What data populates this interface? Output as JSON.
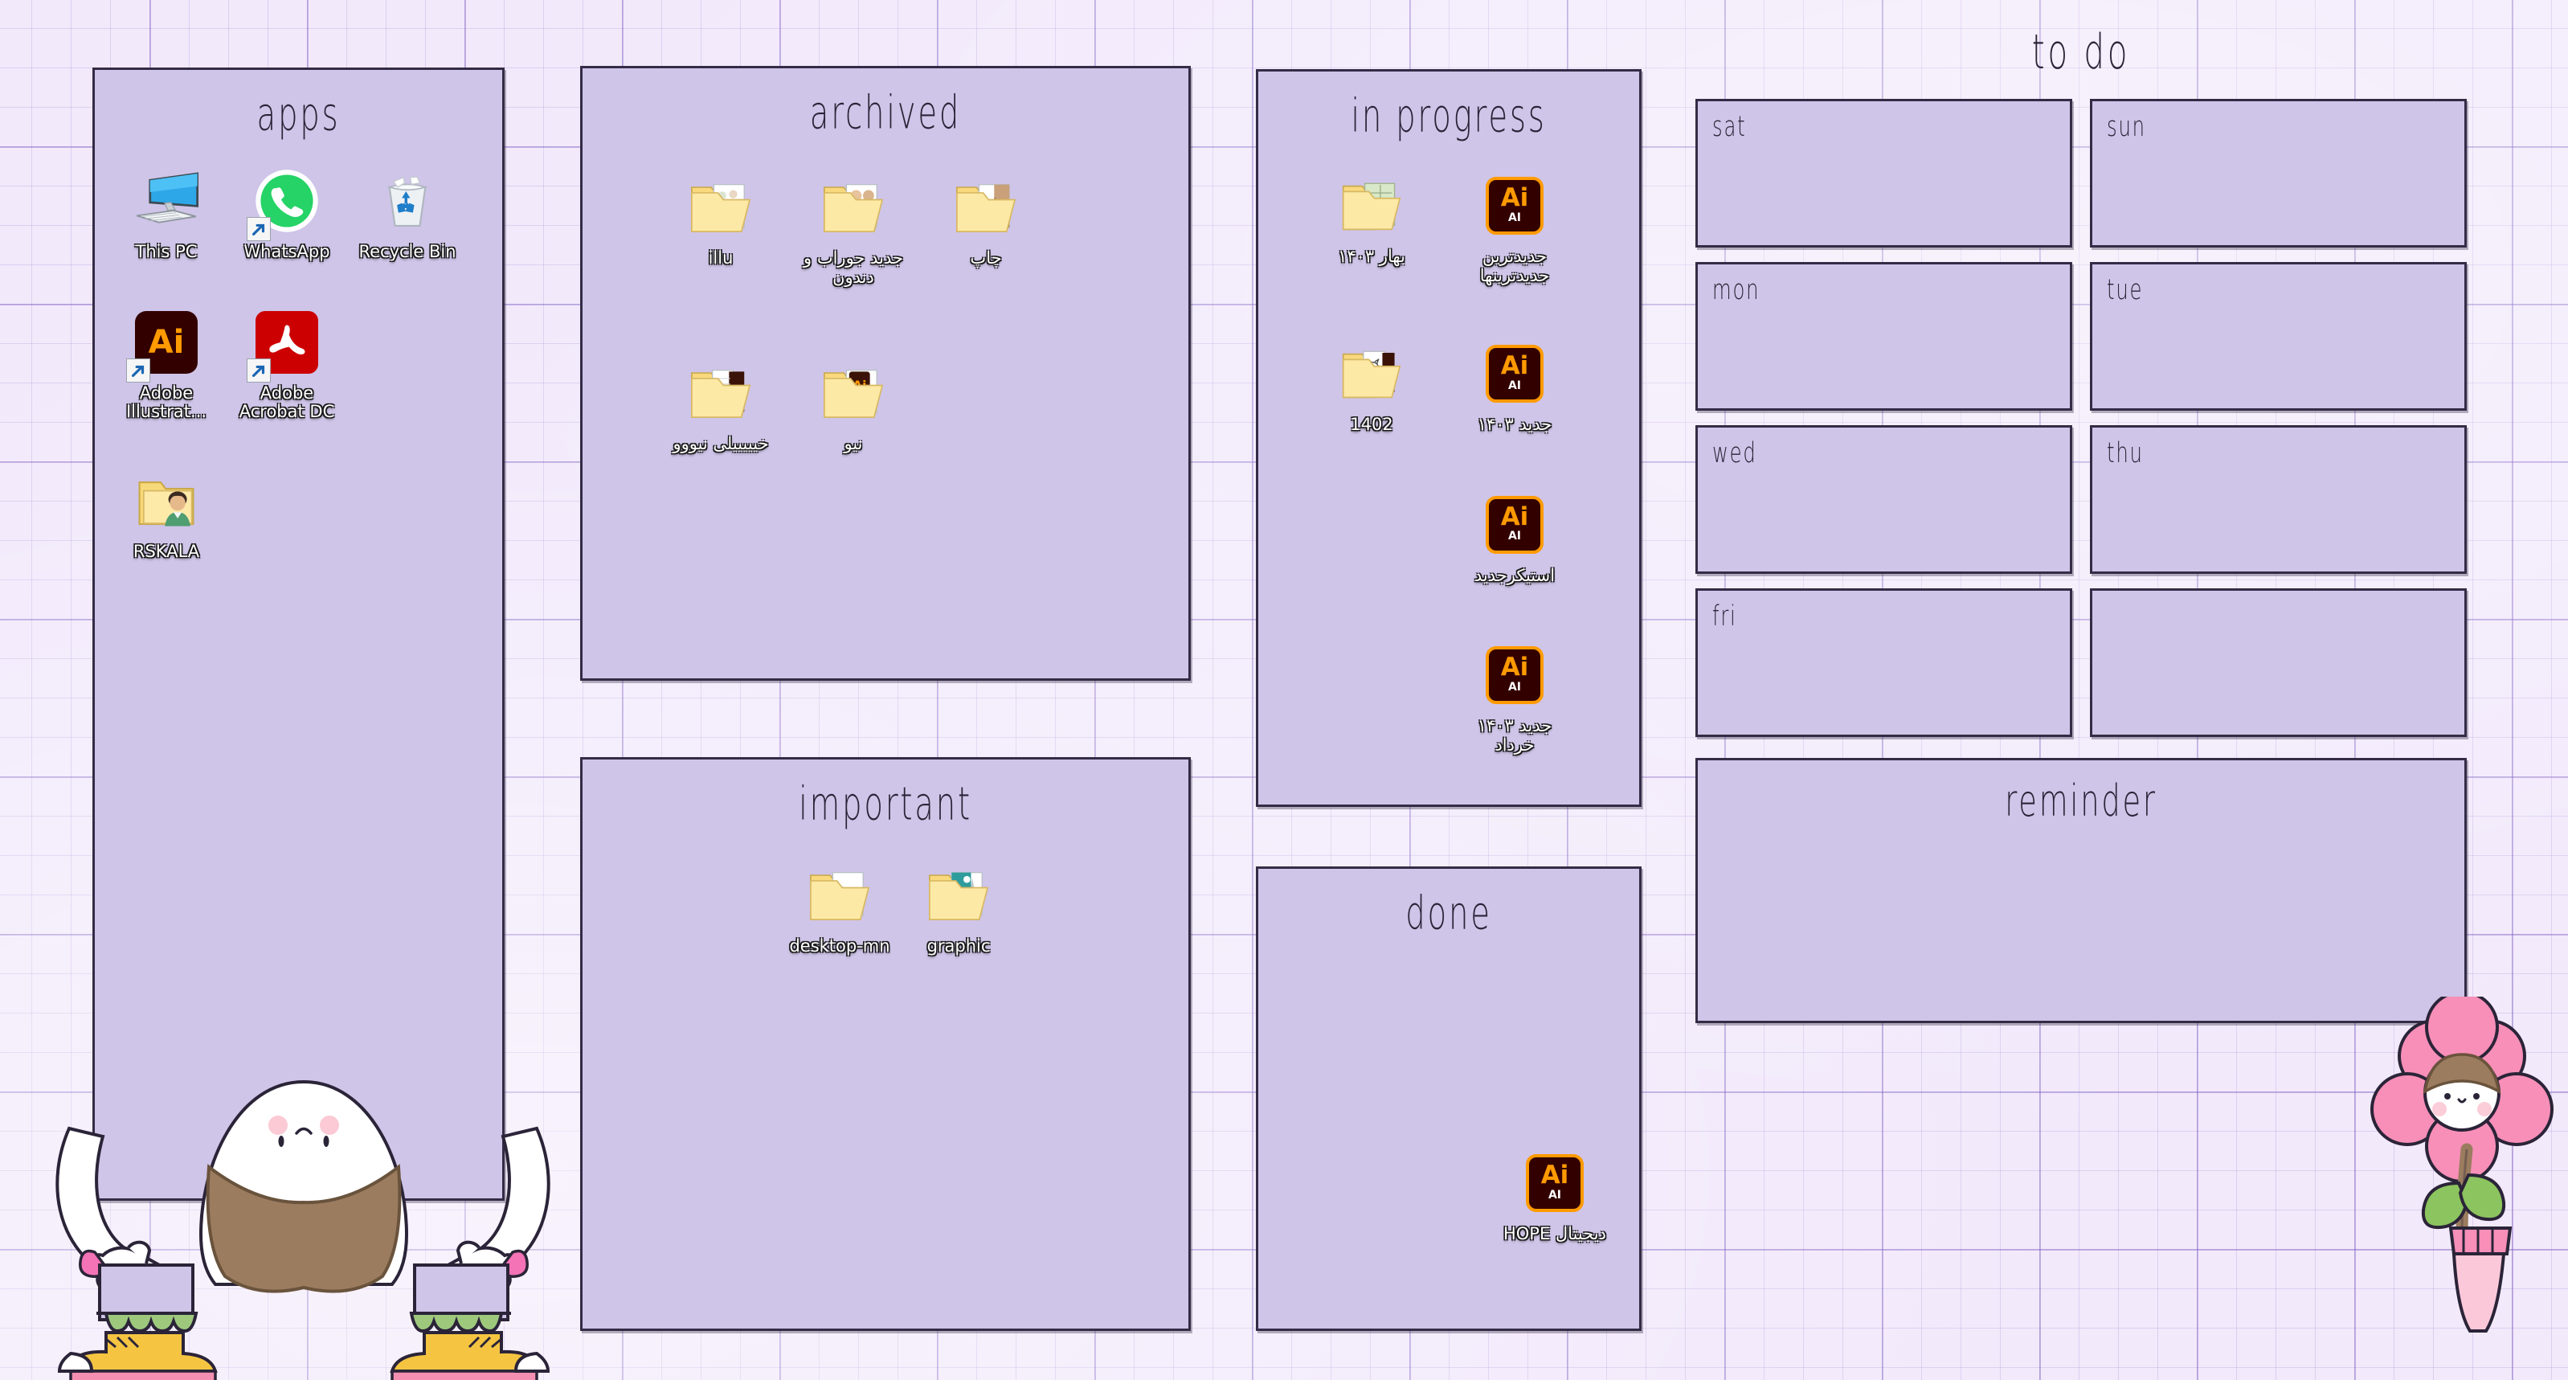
{
  "wallpaper": {
    "style": "grid-paper",
    "background_color": "#f2e9fb",
    "grid_line_color": "#7858be",
    "panel_color": "#cfc5e8",
    "panel_border_color": "#342b46"
  },
  "panels": {
    "apps": {
      "title": "apps",
      "icons": [
        {
          "label": "This PC",
          "icon": "this-pc-icon",
          "shortcut": false
        },
        {
          "label": "WhatsApp",
          "icon": "whatsapp-icon",
          "shortcut": true
        },
        {
          "label": "Recycle Bin",
          "icon": "recycle-bin-icon",
          "shortcut": false
        },
        {
          "label": "Adobe Illustrat...",
          "icon": "adobe-illustrator-icon",
          "shortcut": true
        },
        {
          "label": "Adobe Acrobat DC",
          "icon": "adobe-acrobat-icon",
          "shortcut": true
        },
        {
          "label": "RSKALA",
          "icon": "user-folder-icon",
          "shortcut": false
        }
      ]
    },
    "archived": {
      "title": "archived",
      "icons": [
        {
          "label": "illu",
          "icon": "folder-icon"
        },
        {
          "label": "جدید جوراب و دندون",
          "icon": "folder-icon"
        },
        {
          "label": "چاپ",
          "icon": "folder-icon"
        },
        {
          "label": "خیییییلی نیووو",
          "icon": "folder-icon"
        },
        {
          "label": "نیو",
          "icon": "folder-icon"
        }
      ]
    },
    "important": {
      "title": "important",
      "icons": [
        {
          "label": "desktop-mn",
          "icon": "folder-icon"
        },
        {
          "label": "graphic",
          "icon": "folder-icon"
        }
      ]
    },
    "in_progress": {
      "title": "in progress",
      "icons": [
        {
          "label": "بهار ۱۴۰۳",
          "icon": "folder-icon"
        },
        {
          "label": "جدیدترین جدیدترینها",
          "icon": "adobe-illustrator-file-icon"
        },
        {
          "label": "1402",
          "icon": "folder-icon"
        },
        {
          "label": "جدید ۱۴۰۳",
          "icon": "adobe-illustrator-file-icon"
        },
        {
          "label": "استیکرجدید",
          "icon": "adobe-illustrator-file-icon"
        },
        {
          "label": "جدید ۱۴۰۳ خرداد",
          "icon": "adobe-illustrator-file-icon"
        }
      ]
    },
    "done": {
      "title": "done",
      "icons": [
        {
          "label": "HOPE دیجیتال",
          "icon": "adobe-illustrator-file-icon"
        }
      ]
    }
  },
  "todo": {
    "title": "to do",
    "days": [
      {
        "label": "sat"
      },
      {
        "label": "sun"
      },
      {
        "label": "mon"
      },
      {
        "label": "tue"
      },
      {
        "label": "wed"
      },
      {
        "label": "thu"
      },
      {
        "label": "fri"
      },
      {
        "label": ""
      }
    ],
    "reminder_title": "reminder"
  },
  "decorations": [
    {
      "name": "cartoon-character",
      "description": "white egg-shaped character with brown hair holding panel, yellow shoes"
    },
    {
      "name": "pink-flower",
      "description": "pink flower with face, green leaves, pink vase"
    }
  ]
}
